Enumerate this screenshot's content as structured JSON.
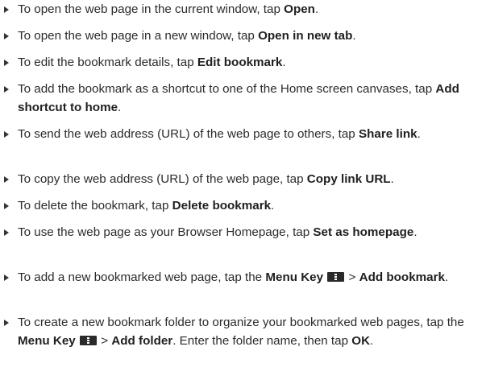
{
  "items": [
    {
      "pre": "To open the web page in the current window, tap ",
      "bold": "Open",
      "post": "."
    },
    {
      "pre": "To open the web page in a new window, tap ",
      "bold": "Open in new tab",
      "post": "."
    },
    {
      "pre": "To edit the bookmark details, tap ",
      "bold": "Edit bookmark",
      "post": "."
    },
    {
      "pre": "To add the bookmark as a shortcut to one of the Home screen canvases, tap ",
      "bold": "Add shortcut to home",
      "post": "."
    },
    {
      "pre": "To send the web address (URL) of the web page to others, tap ",
      "bold": "Share link",
      "post": "."
    },
    {
      "pre": "To copy the web address (URL) of the web page, tap ",
      "bold": "Copy link URL",
      "post": "."
    },
    {
      "pre": "To delete the bookmark, tap ",
      "bold": "Delete bookmark",
      "post": "."
    },
    {
      "pre": "To use the web page as your Browser Homepage, tap ",
      "bold": "Set as homepage",
      "post": "."
    },
    {
      "pre": "To add a new bookmarked web page, tap the ",
      "bold": "Menu Key",
      "mid": " > ",
      "bold2": "Add bookmark",
      "post": "."
    },
    {
      "pre": "To create a new bookmark folder to organize your bookmarked web pages, tap the ",
      "bold": "Menu Key",
      "mid": " > ",
      "bold2": "Add folder",
      "post": ". Enter the folder name, then tap ",
      "bold3": "OK",
      "post2": "."
    }
  ],
  "icons": {
    "menu_key": "menu-key-icon"
  }
}
